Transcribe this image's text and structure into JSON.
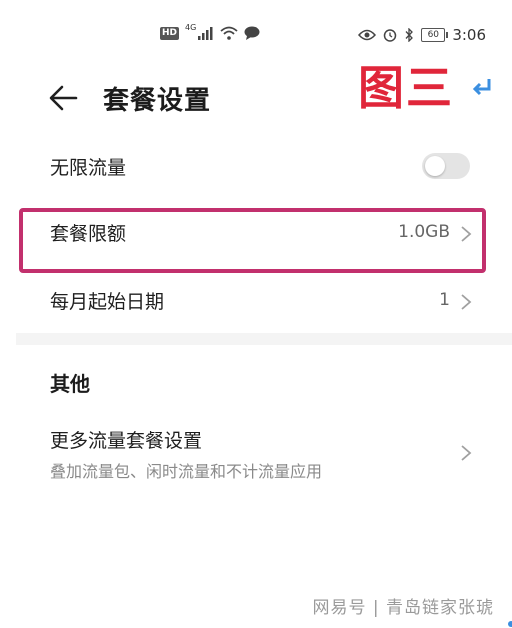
{
  "status_bar": {
    "hd": "HD",
    "network": "4G",
    "battery": "60",
    "time": "3:06"
  },
  "header": {
    "title": "套餐设置",
    "annotation": "图三"
  },
  "settings": {
    "unlimited": {
      "label": "无限流量",
      "toggle_on": false
    },
    "quota": {
      "label": "套餐限额",
      "value": "1.0GB"
    },
    "start_date": {
      "label": "每月起始日期",
      "value": "1"
    }
  },
  "other": {
    "section_title": "其他",
    "more": {
      "label": "更多流量套餐设置",
      "sub": "叠加流量包、闲时流量和不计流量应用"
    }
  },
  "watermark": "网易号 | 青岛链家张琥",
  "colors": {
    "highlight_border": "#c2306d",
    "annotation_red": "#e0263a",
    "annotation_blue": "#3b8fe0"
  }
}
